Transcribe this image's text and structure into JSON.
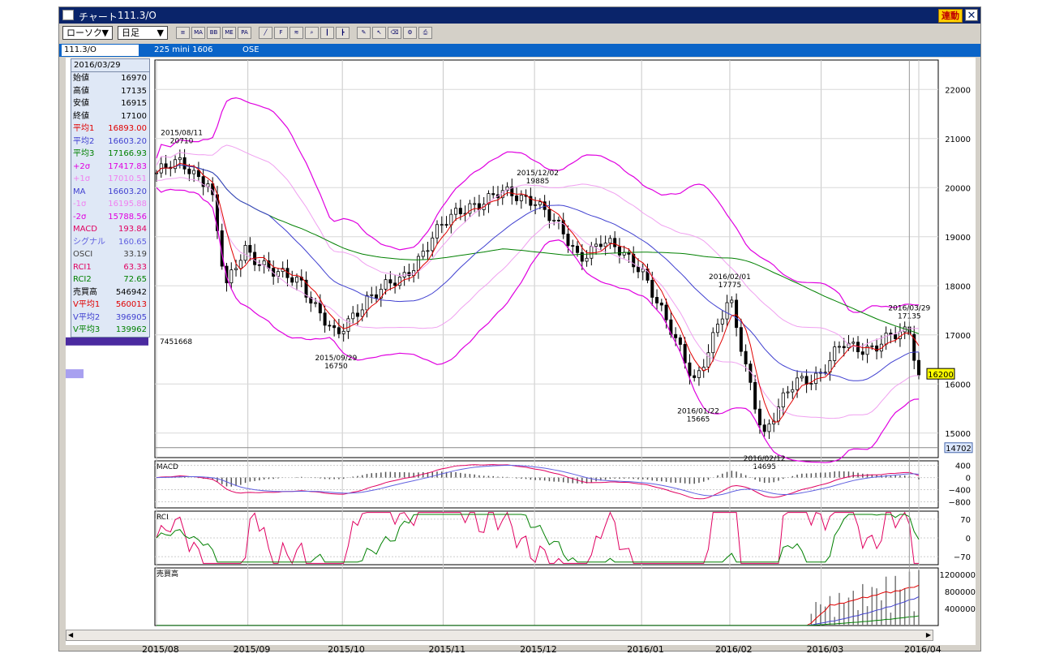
{
  "window": {
    "app_title": "チャート",
    "symbol": "111.3/O",
    "link_button": "連動",
    "close": "✕"
  },
  "toolbar": {
    "chart_type": "ローソク",
    "period": "日足",
    "buttons": [
      {
        "name": "indicator-list-button",
        "label": "≡"
      },
      {
        "name": "ma-button",
        "label": "MA"
      },
      {
        "name": "bb-button",
        "label": "BB"
      },
      {
        "name": "me-button",
        "label": "ME"
      },
      {
        "name": "pa-button",
        "label": "PA"
      },
      {
        "name": "line-tool-button",
        "label": "╱"
      },
      {
        "name": "fib-tool-button",
        "label": "F"
      },
      {
        "name": "wave-tool-button",
        "label": "≋"
      },
      {
        "name": "zoom-button",
        "label": "⌕"
      },
      {
        "name": "candle-style-button",
        "label": "┃"
      },
      {
        "name": "step-button",
        "label": "┣"
      },
      {
        "name": "pen-button",
        "label": "✎"
      },
      {
        "name": "cursor-button",
        "label": "↖"
      },
      {
        "name": "eraser-button",
        "label": "⌫"
      },
      {
        "name": "settings-button",
        "label": "⚙"
      },
      {
        "name": "print-button",
        "label": "⎙"
      }
    ]
  },
  "infobar": {
    "symbol": "111.3/O",
    "name": "225 mini 1606",
    "exchange": "OSE"
  },
  "datapanel": {
    "date": "2016/03/29",
    "rows": [
      {
        "label": "始値",
        "value": "16970",
        "color": "#000000"
      },
      {
        "label": "高値",
        "value": "17135",
        "color": "#000000"
      },
      {
        "label": "安値",
        "value": "16915",
        "color": "#000000"
      },
      {
        "label": "終値",
        "value": "17100",
        "color": "#000000"
      },
      {
        "label": "平均1",
        "value": "16893.00",
        "color": "#e00000"
      },
      {
        "label": "平均2",
        "value": "16603.20",
        "color": "#4040d0"
      },
      {
        "label": "平均3",
        "value": "17166.93",
        "color": "#008000"
      },
      {
        "label": "+2σ",
        "value": "17417.83",
        "color": "#e000e0"
      },
      {
        "label": "+1σ",
        "value": "17010.51",
        "color": "#f080f0"
      },
      {
        "label": "MA",
        "value": "16603.20",
        "color": "#4040d0"
      },
      {
        "label": "-1σ",
        "value": "16195.88",
        "color": "#f080f0"
      },
      {
        "label": "-2σ",
        "value": "15788.56",
        "color": "#e000e0"
      },
      {
        "label": "MACD",
        "value": "193.84",
        "color": "#e00060"
      },
      {
        "label": "シグナル",
        "value": "160.65",
        "color": "#6060e0"
      },
      {
        "label": "OSCI",
        "value": "33.19",
        "color": "#404040"
      },
      {
        "label": "RCI1",
        "value": "63.33",
        "color": "#e00060"
      },
      {
        "label": "RCI2",
        "value": "72.65",
        "color": "#008000"
      },
      {
        "label": "売買高",
        "value": "546942",
        "color": "#000000"
      },
      {
        "label": "V平均1",
        "value": "560013",
        "color": "#e00000"
      },
      {
        "label": "V平均2",
        "value": "396905",
        "color": "#4040d0"
      },
      {
        "label": "V平均3",
        "value": "139962",
        "color": "#008000"
      }
    ]
  },
  "price_panel": {
    "left_value_label": "7451668",
    "current_price": "16200",
    "low_marker": "14702",
    "yticks": [
      "22000",
      "21000",
      "20000",
      "19000",
      "18000",
      "17000",
      "16000",
      "15000"
    ],
    "annotations": [
      {
        "date": "2015/08/11",
        "value": "20710"
      },
      {
        "date": "2015/09/29",
        "value": "16750"
      },
      {
        "date": "2015/12/02",
        "value": "19885"
      },
      {
        "date": "2016/01/22",
        "value": "15665"
      },
      {
        "date": "2016/02/01",
        "value": "17775"
      },
      {
        "date": "2016/02/12",
        "value": "14695"
      },
      {
        "date": "2016/03/29",
        "value": "17135"
      }
    ]
  },
  "macd_panel": {
    "label": "MACD",
    "yticks": [
      "400",
      "0",
      "−400",
      "−800"
    ]
  },
  "rci_panel": {
    "label": "RCI",
    "yticks": [
      "70",
      "0",
      "−70"
    ]
  },
  "volume_panel": {
    "label": "売買高",
    "yticks": [
      "1200000",
      "800000",
      "400000"
    ]
  },
  "xaxis": [
    "2015/08",
    "2015/09",
    "2015/10",
    "2015/11",
    "2015/12",
    "2016/01",
    "2016/02",
    "2016/03",
    "2016/04"
  ],
  "chart_data": {
    "type": "candlestick",
    "anchors": [
      {
        "date": "2015/08/03",
        "value": 20300
      },
      {
        "date": "2015/08/11",
        "value": 20500
      },
      {
        "date": "2015/08/20",
        "value": 20100
      },
      {
        "date": "2015/08/25",
        "value": 17900
      },
      {
        "date": "2015/08/31",
        "value": 18800
      },
      {
        "date": "2015/09/10",
        "value": 18200
      },
      {
        "date": "2015/09/18",
        "value": 18100
      },
      {
        "date": "2015/09/29",
        "value": 16900
      },
      {
        "date": "2015/10/09",
        "value": 17800
      },
      {
        "date": "2015/10/20",
        "value": 18100
      },
      {
        "date": "2015/10/30",
        "value": 19050
      },
      {
        "date": "2015/11/10",
        "value": 19650
      },
      {
        "date": "2015/11/20",
        "value": 19850
      },
      {
        "date": "2015/12/01",
        "value": 19800
      },
      {
        "date": "2015/12/08",
        "value": 19200
      },
      {
        "date": "2015/12/15",
        "value": 18600
      },
      {
        "date": "2015/12/22",
        "value": 18900
      },
      {
        "date": "2016/01/04",
        "value": 18400
      },
      {
        "date": "2016/01/12",
        "value": 17200
      },
      {
        "date": "2016/01/21",
        "value": 16100
      },
      {
        "date": "2016/02/01",
        "value": 17700
      },
      {
        "date": "2016/02/10",
        "value": 15400
      },
      {
        "date": "2016/02/12",
        "value": 14950
      },
      {
        "date": "2016/02/22",
        "value": 16100
      },
      {
        "date": "2016/03/01",
        "value": 16200
      },
      {
        "date": "2016/03/08",
        "value": 16800
      },
      {
        "date": "2016/03/18",
        "value": 16750
      },
      {
        "date": "2016/03/29",
        "value": 17100
      },
      {
        "date": "2016/04/01",
        "value": 16200
      }
    ],
    "ylim": [
      14500,
      22600
    ]
  }
}
